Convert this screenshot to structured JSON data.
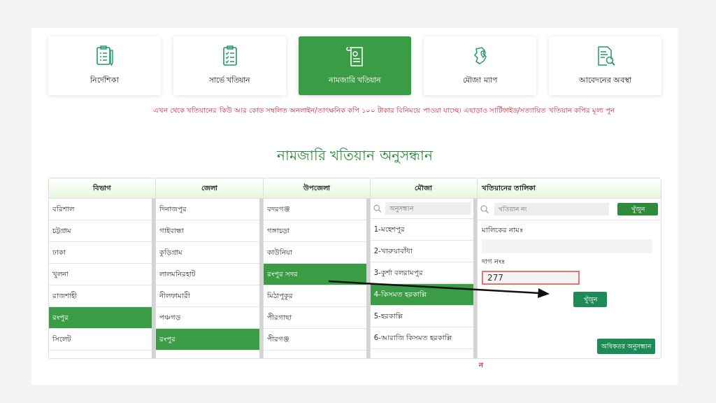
{
  "tiles": [
    {
      "label": "নির্দেশিকা",
      "kind": "guide",
      "selected": false
    },
    {
      "label": "সার্ভে খতিয়ান",
      "kind": "survey",
      "selected": false
    },
    {
      "label": "নামজারি খতিয়ান",
      "kind": "scroll",
      "selected": true
    },
    {
      "label": "মৌজা ম্যাপ",
      "kind": "map",
      "selected": false
    },
    {
      "label": "আবেদনের অবস্থা",
      "kind": "status",
      "selected": false
    }
  ],
  "notice": "এখন থেকে খতিয়ানের কিউ আর কোড সম্বলিত অনলাইন/তাৎক্ষনিক কপি ১০০ টাকার বিনিময়ে পাওয়া যাচ্ছে। এছাড়াও সার্টিফাইড/সত্যায়িত খতিয়ান কপির মূল্য পুন",
  "title": "নামজারি খতিয়ান অনুসন্ধান",
  "columns": [
    {
      "heading": "বিভাগ",
      "items": [
        {
          "label": "বরিশাল",
          "selected": false
        },
        {
          "label": "চট্টগ্রাম",
          "selected": false
        },
        {
          "label": "ঢাকা",
          "selected": false
        },
        {
          "label": "খুলনা",
          "selected": false
        },
        {
          "label": "রাজশাহী",
          "selected": false
        },
        {
          "label": "রংপুর",
          "selected": true
        },
        {
          "label": "সিলেট",
          "selected": false
        }
      ]
    },
    {
      "heading": "জেলা",
      "items": [
        {
          "label": "দিনাজপুর",
          "selected": false
        },
        {
          "label": "গাইবান্ধা",
          "selected": false
        },
        {
          "label": "কুড়িগ্রাম",
          "selected": false
        },
        {
          "label": "লালমনিরহাট",
          "selected": false
        },
        {
          "label": "নীলফামারী",
          "selected": false
        },
        {
          "label": "পঞ্চগড়",
          "selected": false
        },
        {
          "label": "রংপুর",
          "selected": true
        }
      ]
    },
    {
      "heading": "উপজেলা",
      "items": [
        {
          "label": "বদরগঞ্জ",
          "selected": false
        },
        {
          "label": "গঙ্গাচড়া",
          "selected": false
        },
        {
          "label": "কাউনিয়া",
          "selected": false
        },
        {
          "label": "রংপুর সদর",
          "selected": true
        },
        {
          "label": "মিঠাপুকুর",
          "selected": false
        },
        {
          "label": "পীরগাছা",
          "selected": false
        },
        {
          "label": "পীরগঞ্জ",
          "selected": false
        }
      ]
    },
    {
      "heading": "মৌজা",
      "search_placeholder": "অনুসন্ধান",
      "items": [
        {
          "label": "1-মহেশপুর",
          "selected": false
        },
        {
          "label": "2-খারুয়াবাঁধা",
          "selected": false
        },
        {
          "label": "3-কুর্শা বলরামপুর",
          "selected": false
        },
        {
          "label": "4-কিসমত হরকাল্লি",
          "selected": true
        },
        {
          "label": "5-হরকাল্লি",
          "selected": false
        },
        {
          "label": "6-আরাজি কিসমত হরকাল্লি",
          "selected": false
        }
      ]
    }
  ],
  "khatian": {
    "heading": "খতিয়ানের তালিকা",
    "search_placeholder": "খতিয়ান নং",
    "search_button": "খুঁজুন",
    "owner_label": "মালিকের নামঃ",
    "dag_label": "দাগ নংঃ",
    "dag_value": "277",
    "find_button": "খুঁজুন",
    "advanced_button": "অধিকতর অনুসন্ধান"
  },
  "footnote_mark": "ন"
}
